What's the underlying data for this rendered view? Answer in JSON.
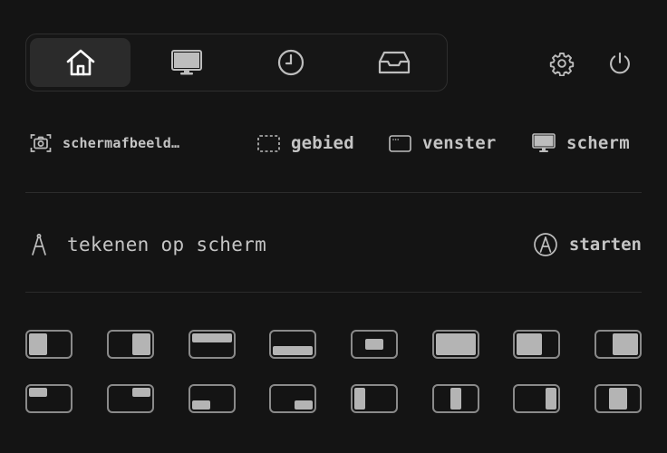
{
  "tabs": [
    {
      "name": "home",
      "icon": "home-icon",
      "active": true
    },
    {
      "name": "display",
      "icon": "monitor-icon",
      "active": false
    },
    {
      "name": "history",
      "icon": "clock-icon",
      "active": false
    },
    {
      "name": "inbox",
      "icon": "inbox-icon",
      "active": false
    }
  ],
  "top_icons": [
    "gear-icon",
    "power-icon"
  ],
  "capture": {
    "screenshot_label": "schermafbeeld…",
    "area_label": "gebied",
    "window_label": "venster",
    "screen_label": "scherm"
  },
  "draw": {
    "label": "tekenen op scherm",
    "start_label": "starten"
  },
  "colors": {
    "background": "#141414",
    "text": "#c4c4c4",
    "icon": "#bdbdbd",
    "active_tab": "#2b2b2b",
    "layout_fill": "#b4b4b4",
    "layout_border": "#8a8a8a"
  },
  "layouts": [
    [
      "left-half",
      "right-half",
      "top-half",
      "bottom-half",
      "center",
      "maximize",
      "left-two-thirds",
      "right-two-thirds"
    ],
    [
      "top-left-quarter",
      "top-right-quarter",
      "bottom-left-quarter",
      "bottom-right-quarter",
      "left-third",
      "center-third",
      "right-third",
      "center-two-thirds"
    ]
  ]
}
